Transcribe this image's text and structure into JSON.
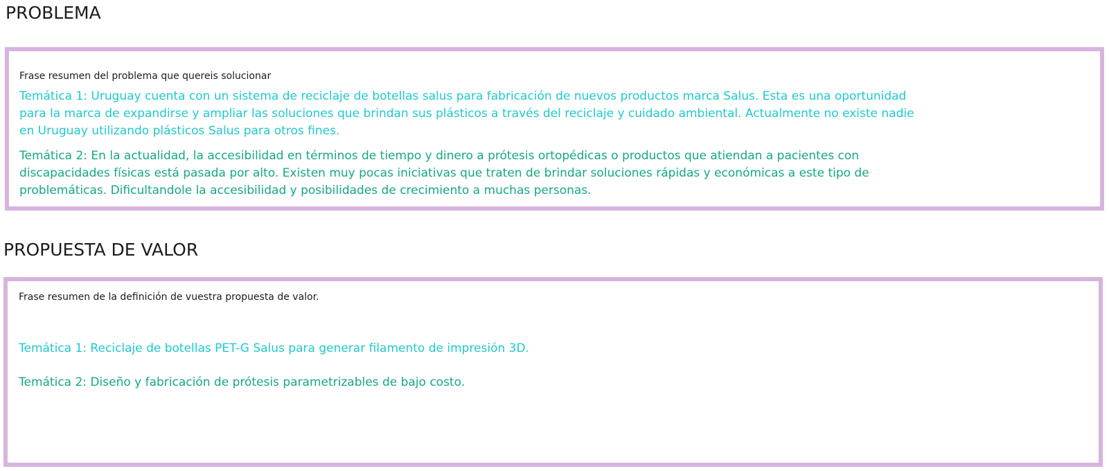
{
  "problema": {
    "title": "PROBLEMA",
    "subtitle": "Frase resumen del problema que quereis solucionar",
    "tema1": "Temática 1: Uruguay cuenta con un sistema de reciclaje de botellas salus para fabricación de nuevos productos marca Salus. Esta es una oportunidad para la marca de expandirse y ampliar las soluciones que brindan sus plásticos a través del reciclaje y cuidado ambiental. Actualmente no existe nadie en Uruguay utilizando plásticos Salus para otros fines.",
    "tema2": "Temática 2: En la actualidad, la accesibilidad en términos de tiempo y dinero a prótesis ortopédicas o productos que atiendan a pacientes con discapacidades físicas está pasada por alto. Existen muy pocas iniciativas que traten de brindar soluciones rápidas y económicas a este tipo de problemáticas. Dificultandole la accesibilidad y posibilidades de crecimiento a muchas personas."
  },
  "propuesta": {
    "title": "PROPUESTA DE VALOR",
    "subtitle": "Frase resumen de la definición de vuestra propuesta de valor.",
    "tema1": "Temática 1: Reciclaje de botellas PET-G Salus para generar filamento de impresión 3D.",
    "tema2": "Temática 2: Diseño y fabricación de prótesis parametrizables de bajo costo."
  },
  "colors": {
    "box_border": "#d7b4e0",
    "theme1_text": "#1fc9cf",
    "theme2_text": "#14a882",
    "heading_text": "#1c1c1c"
  }
}
